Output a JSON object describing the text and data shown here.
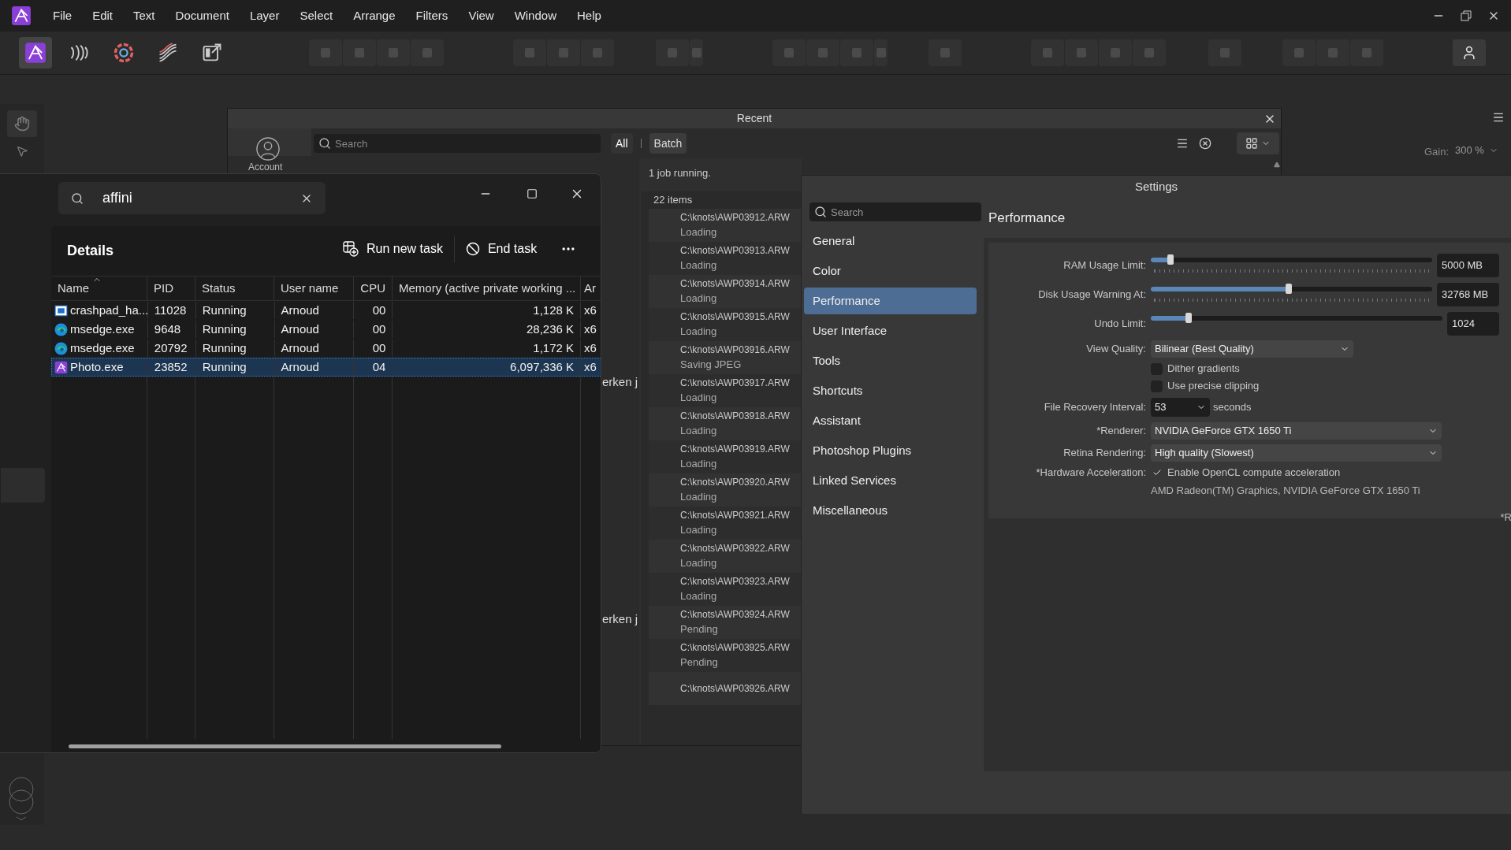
{
  "menu": [
    "File",
    "Edit",
    "Text",
    "Document",
    "Layer",
    "Select",
    "Arrange",
    "Filters",
    "View",
    "Window",
    "Help"
  ],
  "personas": [
    {
      "selected": true
    },
    {
      "selected": false
    },
    {
      "selected": false
    },
    {
      "selected": false
    },
    {
      "selected": false
    }
  ],
  "recent": {
    "title": "Recent",
    "search": {
      "placeholder": "Search"
    },
    "account": "Account",
    "filters": [
      {
        "label": "All",
        "selected": false
      },
      {
        "label": "Batch",
        "selected": true
      }
    ],
    "gain_label": "Gain:",
    "gain": "300 %",
    "cut_texts": [
      "erken j",
      "erken j"
    ]
  },
  "batch": {
    "status": "1 job running.",
    "count": "22 items",
    "jobs": [
      {
        "path": "C:\\knots\\AWP03912.ARW",
        "status": "Loading"
      },
      {
        "path": "C:\\knots\\AWP03913.ARW",
        "status": "Loading"
      },
      {
        "path": "C:\\knots\\AWP03914.ARW",
        "status": "Loading"
      },
      {
        "path": "C:\\knots\\AWP03915.ARW",
        "status": "Loading"
      },
      {
        "path": "C:\\knots\\AWP03916.ARW",
        "status": "Saving JPEG"
      },
      {
        "path": "C:\\knots\\AWP03917.ARW",
        "status": "Loading"
      },
      {
        "path": "C:\\knots\\AWP03918.ARW",
        "status": "Loading"
      },
      {
        "path": "C:\\knots\\AWP03919.ARW",
        "status": "Loading"
      },
      {
        "path": "C:\\knots\\AWP03920.ARW",
        "status": "Loading"
      },
      {
        "path": "C:\\knots\\AWP03921.ARW",
        "status": "Loading"
      },
      {
        "path": "C:\\knots\\AWP03922.ARW",
        "status": "Loading"
      },
      {
        "path": "C:\\knots\\AWP03923.ARW",
        "status": "Loading"
      },
      {
        "path": "C:\\knots\\AWP03924.ARW",
        "status": "Pending"
      },
      {
        "path": "C:\\knots\\AWP03925.ARW",
        "status": "Pending"
      },
      {
        "path": "C:\\knots\\AWP03926.ARW"
      }
    ]
  },
  "task_manager": {
    "search": {
      "value": "affini"
    },
    "title": "Details",
    "actions": [
      {
        "kind": "run",
        "label": "Run new task"
      },
      {
        "kind": "end",
        "label": "End task"
      }
    ],
    "columns": [
      "Name",
      "PID",
      "Status",
      "User name",
      "CPU",
      "Memory (active private working ...",
      "Ar"
    ],
    "rows": [
      {
        "kind": "crashpad",
        "selected": false,
        "cells": [
          "crashpad_ha...",
          "11028",
          "Running",
          "Arnoud",
          "00",
          "1,128 K",
          "x6"
        ]
      },
      {
        "kind": "edge",
        "selected": false,
        "cells": [
          "msedge.exe",
          "9648",
          "Running",
          "Arnoud",
          "00",
          "28,236 K",
          "x6"
        ]
      },
      {
        "kind": "edge",
        "selected": false,
        "cells": [
          "msedge.exe",
          "20792",
          "Running",
          "Arnoud",
          "00",
          "1,172 K",
          "x6"
        ]
      },
      {
        "kind": "photo",
        "selected": true,
        "cells": [
          "Photo.exe",
          "23852",
          "Running",
          "Arnoud",
          "04",
          "6,097,336 K",
          "x6"
        ]
      }
    ]
  },
  "settings": {
    "title": "Settings",
    "search": {
      "placeholder": "Search"
    },
    "nav": [
      {
        "label": "General",
        "selected": false
      },
      {
        "label": "Color",
        "selected": false
      },
      {
        "label": "Performance",
        "selected": true
      },
      {
        "label": "User Interface",
        "selected": false
      },
      {
        "label": "Tools",
        "selected": false
      },
      {
        "label": "Shortcuts",
        "selected": false
      },
      {
        "label": "Assistant",
        "selected": false
      },
      {
        "label": "Photoshop Plugins",
        "selected": false
      },
      {
        "label": "Linked Services",
        "selected": false
      },
      {
        "label": "Miscellaneous",
        "selected": false
      }
    ],
    "heading": "Performance",
    "rows": [
      {
        "kind": "slider",
        "label": "RAM Usage Limit:",
        "level": 0.07,
        "value": "5000 MB"
      },
      {
        "kind": "slider",
        "label": "Disk Usage Warning At:",
        "level": 0.49,
        "value": "32768 MB"
      },
      {
        "kind": "slider",
        "label": "Undo Limit:",
        "level": 0.13,
        "value": "1024"
      },
      {
        "kind": "select",
        "label": "View Quality:",
        "value": "Bilinear (Best Quality)"
      },
      {
        "kind": "checkbox",
        "text": "Dither gradients",
        "checked": false
      },
      {
        "kind": "checkbox",
        "text": "Use precise clipping",
        "checked": false
      },
      {
        "kind": "interval",
        "label": "File Recovery Interval:",
        "value": "53",
        "unit": "seconds"
      },
      {
        "kind": "wide_select",
        "label": "*Renderer:",
        "value": "NVIDIA GeForce GTX 1650 Ti"
      },
      {
        "kind": "wide_select",
        "label": "Retina Rendering:",
        "value": "High quality (Slowest)"
      },
      {
        "kind": "checkbox",
        "label": "*Hardware Acceleration:",
        "text": "Enable OpenCL compute acceleration",
        "checked": true
      },
      {
        "kind": "note",
        "text": "AMD Radeon(TM) Graphics, NVIDIA GeForce GTX 1650 Ti"
      }
    ],
    "footnote": "*R"
  }
}
